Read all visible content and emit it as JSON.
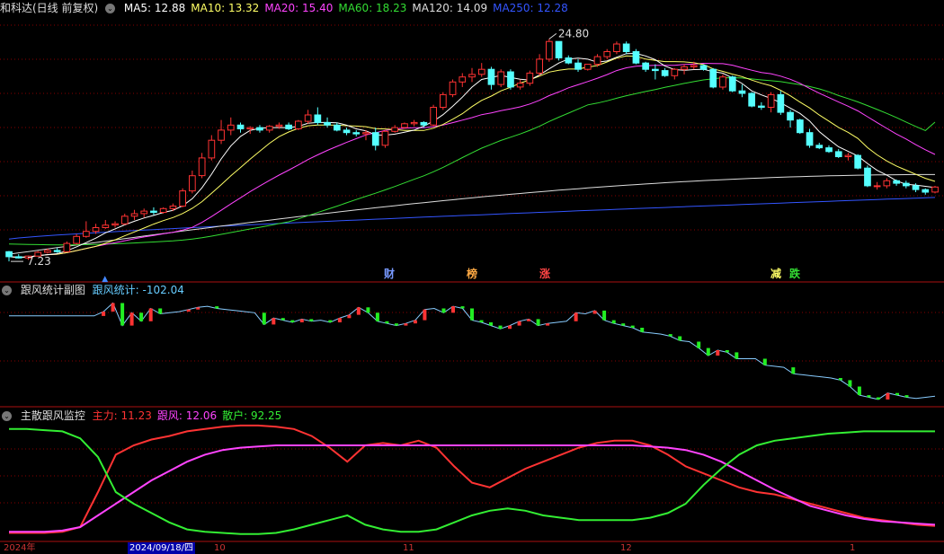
{
  "panel1": {
    "title": "和科达(日线 前复权)",
    "indicators": [
      {
        "label": "MA5: 12.88",
        "color": "#ffffff"
      },
      {
        "label": "MA10: 13.32",
        "color": "#ffff66"
      },
      {
        "label": "MA20: 15.40",
        "color": "#ff44ff"
      },
      {
        "label": "MA60: 18.23",
        "color": "#33dd33"
      },
      {
        "label": "MA120: 14.09",
        "color": "#dddddd"
      },
      {
        "label": "MA250: 12.28",
        "color": "#3355ff"
      }
    ],
    "high_label": "24.80",
    "low_label": "7.23",
    "up_arrow": "▲",
    "events": [
      {
        "text": "财",
        "color": "#7799ff"
      },
      {
        "text": "榜",
        "color": "#ffaa44"
      },
      {
        "text": "涨",
        "color": "#ff4444"
      },
      {
        "text": "减",
        "color": "#ffff66"
      },
      {
        "text": "跌",
        "color": "#33dd33"
      }
    ]
  },
  "panel2": {
    "title": "跟风统计副图",
    "value_label": "跟风统计: -102.04",
    "value_color": "#66ccff"
  },
  "panel3": {
    "title": "主散跟风监控",
    "items": [
      {
        "label": "主力: 11.23",
        "color": "#ff3333"
      },
      {
        "label": "跟风: 12.06",
        "color": "#ff44ff"
      },
      {
        "label": "散户: 92.25",
        "color": "#33ee33"
      }
    ]
  },
  "axis": {
    "ticks": [
      "2024年",
      "2024/09/18/四",
      "10",
      "11",
      "12",
      "1"
    ],
    "selected_date": "2024/09/18/四"
  },
  "colors": {
    "up": "#ff3333",
    "down": "#55ffff",
    "grid": "#880000",
    "border": "#aa1111"
  },
  "chart_data": [
    {
      "type": "candlestick",
      "title": "和科达(日线 前复权)",
      "annotations": [
        "24.80",
        "7.23"
      ],
      "ohlc": [
        [
          8.0,
          8.05,
          7.23,
          7.6
        ],
        [
          7.6,
          7.8,
          7.45,
          7.5
        ],
        [
          7.5,
          7.7,
          7.35,
          7.65
        ],
        [
          7.65,
          8.05,
          7.6,
          7.95
        ],
        [
          7.95,
          8.25,
          7.85,
          8.1
        ],
        [
          8.1,
          8.3,
          7.9,
          8.0
        ],
        [
          8.0,
          8.8,
          7.95,
          8.65
        ],
        [
          8.65,
          9.4,
          8.55,
          9.2
        ],
        [
          9.2,
          10.4,
          9.1,
          9.6
        ],
        [
          9.6,
          10.2,
          9.4,
          9.9
        ],
        [
          9.9,
          10.5,
          9.8,
          10.1
        ],
        [
          10.1,
          10.4,
          9.9,
          10.2
        ],
        [
          10.2,
          11.0,
          10.1,
          10.8
        ],
        [
          10.8,
          11.3,
          10.5,
          11.0
        ],
        [
          11.0,
          11.4,
          10.7,
          11.2
        ],
        [
          11.2,
          11.5,
          10.9,
          11.1
        ],
        [
          11.1,
          11.5,
          11.0,
          11.4
        ],
        [
          11.4,
          11.8,
          11.2,
          11.6
        ],
        [
          11.6,
          13.0,
          11.5,
          12.8
        ],
        [
          12.8,
          14.4,
          12.6,
          14.0
        ],
        [
          14.0,
          15.8,
          13.8,
          15.4
        ],
        [
          15.4,
          17.2,
          15.2,
          16.8
        ],
        [
          16.8,
          18.4,
          16.5,
          17.6
        ],
        [
          17.6,
          18.6,
          17.2,
          18.0
        ],
        [
          18.0,
          18.2,
          17.4,
          17.7
        ],
        [
          17.7,
          17.9,
          17.3,
          17.8
        ],
        [
          17.8,
          18.0,
          17.4,
          17.6
        ],
        [
          17.6,
          18.0,
          17.4,
          17.9
        ],
        [
          17.9,
          18.2,
          17.7,
          18.0
        ],
        [
          18.0,
          18.2,
          17.6,
          17.7
        ],
        [
          17.7,
          18.4,
          17.6,
          18.3
        ],
        [
          18.3,
          19.2,
          18.1,
          18.8
        ],
        [
          18.8,
          19.4,
          18.0,
          18.2
        ],
        [
          18.2,
          18.6,
          17.8,
          18.0
        ],
        [
          18.0,
          18.2,
          17.5,
          17.6
        ],
        [
          17.6,
          17.8,
          17.2,
          17.4
        ],
        [
          17.4,
          17.6,
          17.1,
          17.3
        ],
        [
          17.3,
          17.6,
          16.8,
          17.4
        ],
        [
          17.4,
          17.8,
          16.0,
          16.4
        ],
        [
          16.4,
          17.6,
          16.2,
          17.5
        ],
        [
          17.5,
          18.0,
          17.4,
          17.8
        ],
        [
          17.8,
          18.2,
          17.7,
          18.1
        ],
        [
          18.1,
          18.4,
          17.9,
          18.2
        ],
        [
          18.2,
          18.3,
          17.8,
          18.0
        ],
        [
          18.0,
          19.6,
          17.9,
          19.4
        ],
        [
          19.4,
          20.6,
          19.2,
          20.4
        ],
        [
          20.4,
          21.6,
          20.2,
          21.4
        ],
        [
          21.4,
          22.1,
          21.0,
          21.8
        ],
        [
          21.8,
          22.5,
          21.4,
          22.0
        ],
        [
          22.0,
          22.9,
          21.8,
          22.4
        ],
        [
          22.4,
          22.6,
          20.8,
          21.2
        ],
        [
          21.2,
          22.4,
          21.0,
          22.2
        ],
        [
          22.2,
          22.4,
          20.8,
          21.0
        ],
        [
          21.0,
          21.6,
          20.8,
          21.3
        ],
        [
          21.3,
          22.3,
          21.1,
          22.1
        ],
        [
          22.1,
          23.6,
          21.9,
          23.2
        ],
        [
          23.2,
          24.8,
          23.0,
          24.6
        ],
        [
          24.6,
          24.6,
          23.1,
          23.3
        ],
        [
          23.3,
          23.5,
          22.8,
          22.9
        ],
        [
          22.9,
          23.2,
          22.2,
          22.4
        ],
        [
          22.4,
          22.8,
          22.3,
          22.8
        ],
        [
          22.8,
          23.6,
          22.6,
          23.4
        ],
        [
          23.4,
          24.0,
          23.2,
          23.8
        ],
        [
          23.8,
          24.6,
          23.6,
          24.4
        ],
        [
          24.4,
          24.6,
          23.6,
          23.8
        ],
        [
          23.8,
          24.0,
          22.8,
          22.9
        ],
        [
          22.9,
          23.0,
          22.2,
          22.4
        ],
        [
          22.4,
          22.8,
          21.6,
          22.3
        ],
        [
          22.3,
          22.5,
          21.8,
          21.9
        ],
        [
          21.9,
          22.5,
          21.6,
          22.4
        ],
        [
          22.4,
          22.8,
          22.0,
          22.6
        ],
        [
          22.6,
          23.0,
          22.4,
          22.7
        ],
        [
          22.7,
          22.8,
          22.3,
          22.4
        ],
        [
          22.4,
          22.5,
          20.9,
          21.0
        ],
        [
          21.0,
          22.0,
          20.8,
          21.8
        ],
        [
          21.8,
          21.9,
          20.6,
          20.7
        ],
        [
          20.7,
          21.2,
          20.2,
          20.5
        ],
        [
          20.5,
          20.6,
          19.4,
          19.5
        ],
        [
          19.5,
          19.8,
          19.2,
          19.4
        ],
        [
          19.4,
          20.6,
          19.0,
          20.4
        ],
        [
          20.4,
          20.7,
          18.8,
          19.0
        ],
        [
          19.0,
          19.2,
          17.8,
          18.4
        ],
        [
          18.4,
          18.5,
          17.3,
          17.4
        ],
        [
          17.4,
          17.7,
          16.2,
          16.4
        ],
        [
          16.4,
          16.6,
          16.1,
          16.2
        ],
        [
          16.2,
          16.4,
          15.8,
          15.9
        ],
        [
          15.9,
          16.1,
          15.4,
          15.5
        ],
        [
          15.5,
          15.8,
          15.2,
          15.6
        ],
        [
          15.6,
          15.7,
          14.5,
          14.6
        ],
        [
          14.6,
          14.8,
          13.1,
          13.2
        ],
        [
          13.2,
          13.5,
          12.9,
          13.2
        ],
        [
          13.2,
          13.8,
          13.0,
          13.6
        ],
        [
          13.6,
          13.7,
          13.2,
          13.4
        ],
        [
          13.4,
          13.6,
          13.0,
          13.2
        ],
        [
          13.2,
          13.4,
          12.7,
          12.9
        ],
        [
          12.9,
          13.0,
          12.5,
          12.7
        ],
        [
          12.7,
          13.2,
          12.6,
          13.1
        ]
      ],
      "ma_series": {
        "MA5": {
          "last": 12.88,
          "color": "#ffffff"
        },
        "MA10": {
          "last": 13.32,
          "color": "#ffff66"
        },
        "MA20": {
          "last": 15.4,
          "color": "#ff44ff"
        },
        "MA60": {
          "last": 18.23,
          "color": "#33dd33"
        },
        "MA120": {
          "last": 14.09,
          "color": "#dddddd"
        },
        "MA250": {
          "last": 12.28,
          "color": "#3355ff"
        }
      }
    },
    {
      "type": "bar",
      "title": "跟风统计副图",
      "series_name": "跟风统计",
      "last": -102.04,
      "values": [
        0,
        0,
        0,
        0,
        0,
        0,
        0,
        0,
        0,
        0,
        20,
        60,
        -45,
        15,
        -25,
        35,
        10,
        15,
        20,
        30,
        40,
        45,
        35,
        30,
        25,
        20,
        15,
        -40,
        -10,
        -20,
        -30,
        -15,
        -25,
        -20,
        -30,
        -10,
        5,
        40,
        15,
        -25,
        -35,
        -45,
        -35,
        -20,
        30,
        35,
        15,
        45,
        35,
        -20,
        -30,
        -45,
        -60,
        -45,
        -25,
        -15,
        -45,
        -35,
        -30,
        -25,
        15,
        10,
        25,
        -20,
        -35,
        -45,
        -55,
        -75,
        -80,
        -85,
        -95,
        -115,
        -120,
        -150,
        -185,
        -160,
        -170,
        -200,
        -200,
        -200,
        -230,
        -235,
        -240,
        -270,
        -275,
        -280,
        -285,
        -290,
        -300,
        -330,
        -370,
        -380,
        -390,
        -360,
        -370,
        -380,
        -385,
        -380,
        -375
      ],
      "colors_by_sign": {
        "up": "#ff3333",
        "down": "#22ee22"
      }
    },
    {
      "type": "line",
      "title": "主散跟风监控",
      "series": [
        {
          "name": "主力",
          "last": 11.23,
          "color": "#ff3333",
          "values": [
            5,
            5,
            5,
            6,
            10,
            40,
            72,
            80,
            85,
            88,
            92,
            94,
            96,
            97,
            97,
            96,
            94,
            88,
            78,
            66,
            80,
            82,
            80,
            84,
            78,
            62,
            48,
            44,
            52,
            60,
            66,
            72,
            78,
            82,
            84,
            84,
            80,
            72,
            62,
            56,
            50,
            44,
            40,
            38,
            34,
            30,
            26,
            22,
            18,
            16,
            14,
            12,
            11
          ]
        },
        {
          "name": "跟风",
          "last": 12.06,
          "color": "#ff44ff",
          "values": [
            6,
            6,
            6,
            7,
            10,
            20,
            30,
            40,
            50,
            58,
            66,
            72,
            76,
            78,
            79,
            80,
            80,
            80,
            80,
            80,
            80,
            80,
            80,
            80,
            80,
            80,
            80,
            80,
            80,
            80,
            80,
            80,
            80,
            80,
            80,
            80,
            79,
            78,
            76,
            72,
            66,
            58,
            50,
            42,
            35,
            28,
            24,
            20,
            17,
            15,
            14,
            13,
            12
          ]
        },
        {
          "name": "散户",
          "last": 92.25,
          "color": "#33ee33",
          "values": [
            94,
            94,
            93,
            92,
            86,
            70,
            40,
            30,
            22,
            14,
            8,
            6,
            5,
            4,
            4,
            5,
            8,
            12,
            16,
            20,
            12,
            8,
            6,
            6,
            8,
            14,
            20,
            24,
            26,
            24,
            20,
            18,
            16,
            16,
            16,
            16,
            18,
            22,
            30,
            46,
            60,
            72,
            80,
            84,
            86,
            88,
            90,
            91,
            92,
            92,
            92,
            92,
            92
          ]
        }
      ]
    }
  ]
}
